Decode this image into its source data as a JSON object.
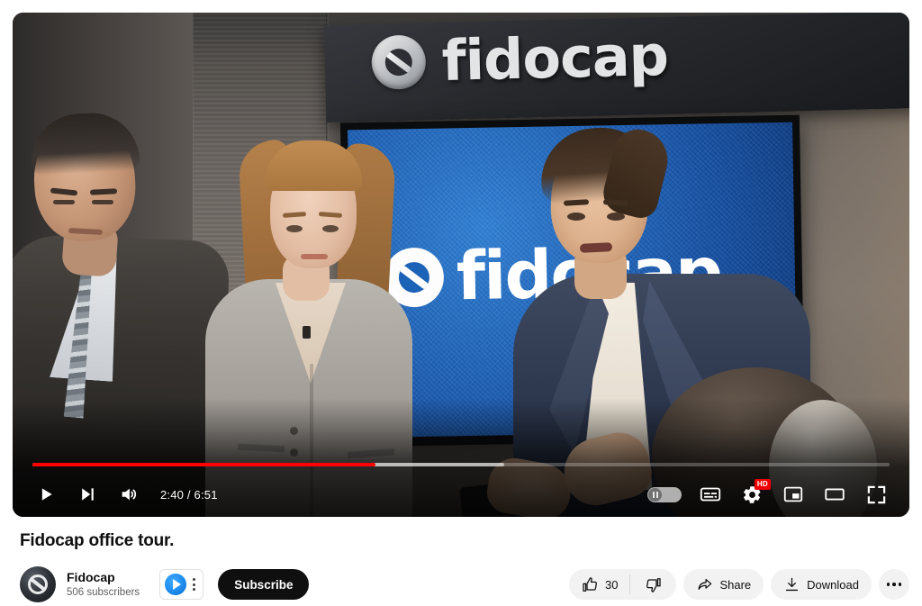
{
  "player": {
    "time_display": "2:40 / 6:51",
    "current_time": "2:40",
    "duration": "6:51",
    "progress_percent": 40,
    "buffered_percent": 55,
    "progress_color": "#ff0000",
    "quality_badge": "HD",
    "autoplay_state": "on",
    "controls": {
      "play_label": "Play",
      "next_label": "Next",
      "volume_label": "Mute",
      "autoplay_label": "Autoplay",
      "subtitles_label": "Subtitles/closed captions (c)",
      "settings_label": "Settings",
      "miniplayer_label": "Miniplayer (i)",
      "theater_label": "Theater mode (t)",
      "fullscreen_label": "Full screen (f)"
    }
  },
  "video_scene": {
    "sign_text": "fidocap",
    "tv_screen_text": "fidocap",
    "brand_blue": "#1e62b8"
  },
  "video": {
    "title": "Fidocap office tour."
  },
  "channel": {
    "name": "Fidocap",
    "subscribers": "506 subscribers",
    "subscribe_label": "Subscribe"
  },
  "actions": {
    "like_count": "30",
    "like_label": "Like",
    "dislike_label": "Dislike",
    "share_label": "Share",
    "download_label": "Download",
    "more_label": "More actions"
  }
}
